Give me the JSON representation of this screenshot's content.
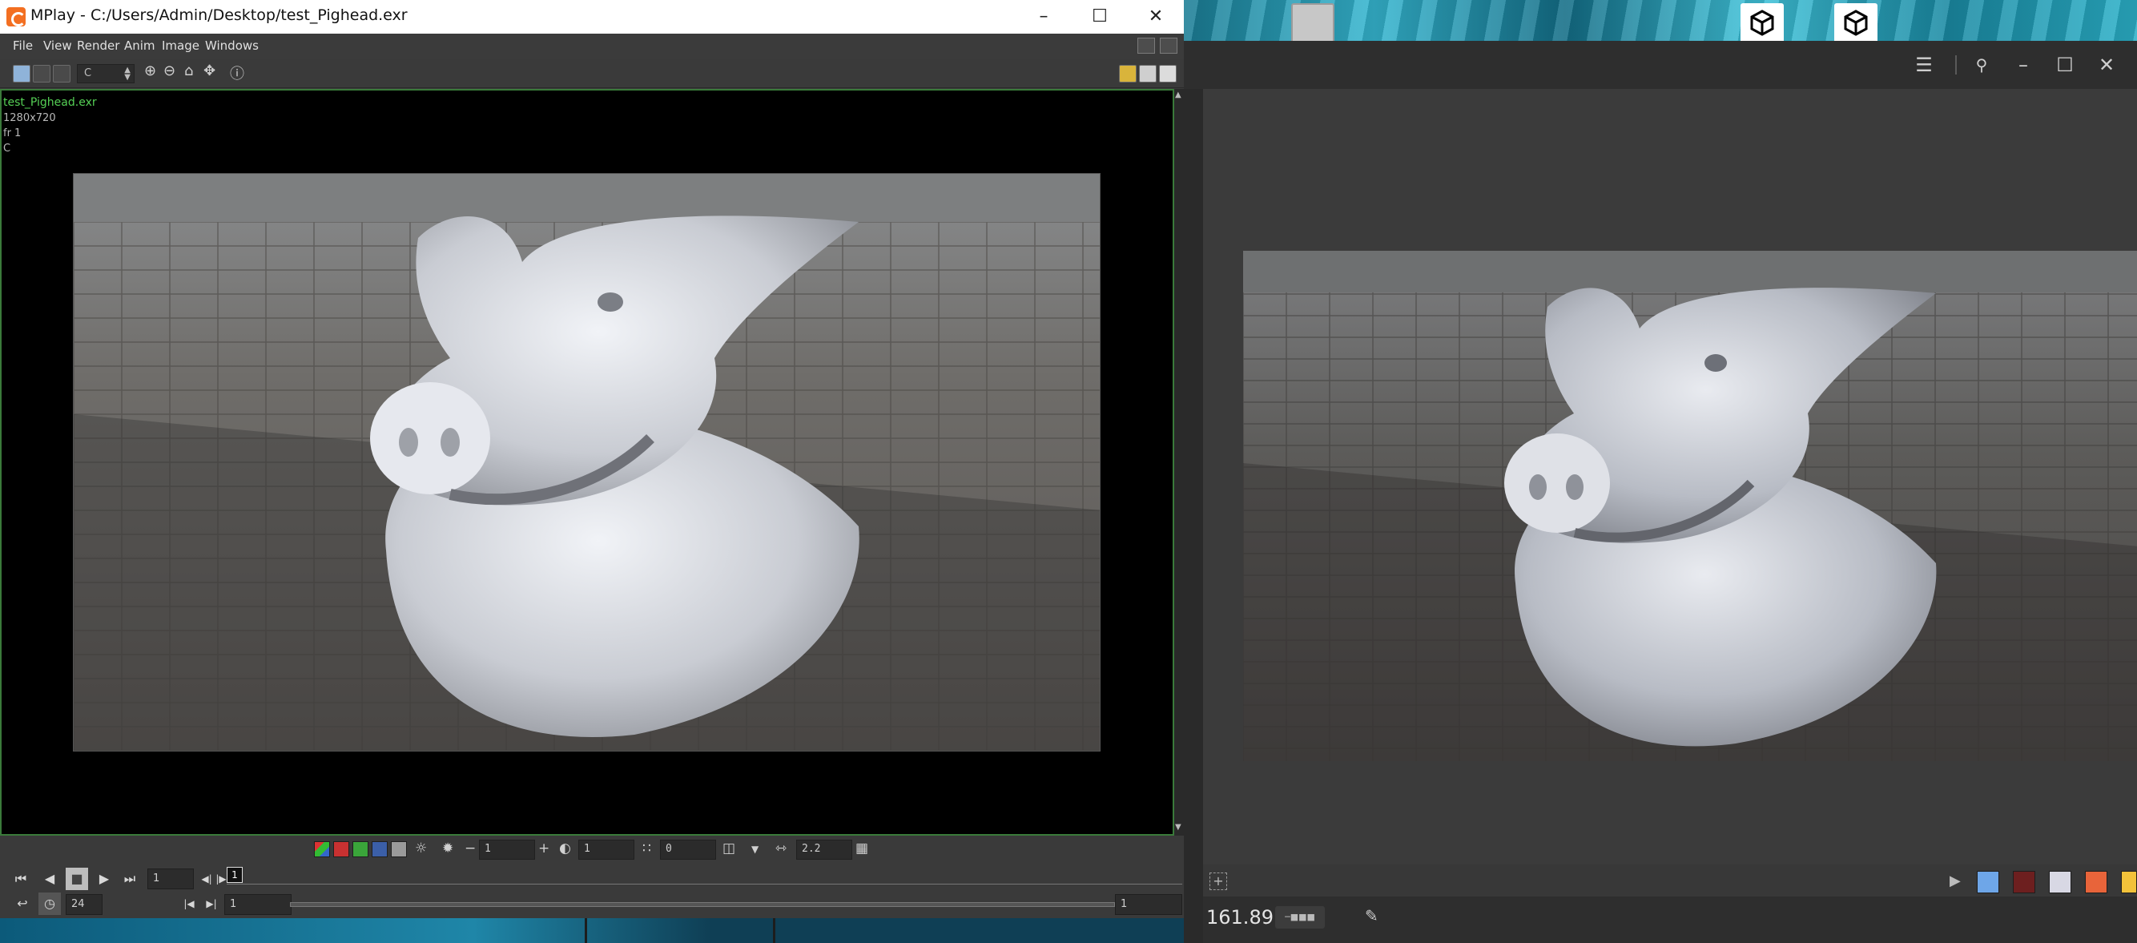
{
  "mplay": {
    "title": "MPlay - C:/Users/Admin/Desktop/test_Pighead.exr",
    "menus": [
      "File",
      "View",
      "Render",
      "Anim",
      "Image",
      "Windows"
    ],
    "toolbar": {
      "channel": "C"
    },
    "overlay": {
      "filename": "test_Pighead.exr",
      "resolution": "1280x720",
      "frame": "fr 1",
      "channel": "C"
    },
    "color_bar": {
      "field1": "1",
      "field2": "1",
      "field3": "0",
      "gamma": "2.2"
    },
    "timeline": {
      "current_frame": "1",
      "frame_marker": "1",
      "fps": "24",
      "range_start": "1",
      "range_end": "1"
    }
  },
  "right_window": {
    "zoom": "161.89",
    "swatches": [
      "#6ea6e8",
      "#6d1f1f",
      "#d8d8e4",
      "#e8643a",
      "#f2c23a"
    ]
  }
}
